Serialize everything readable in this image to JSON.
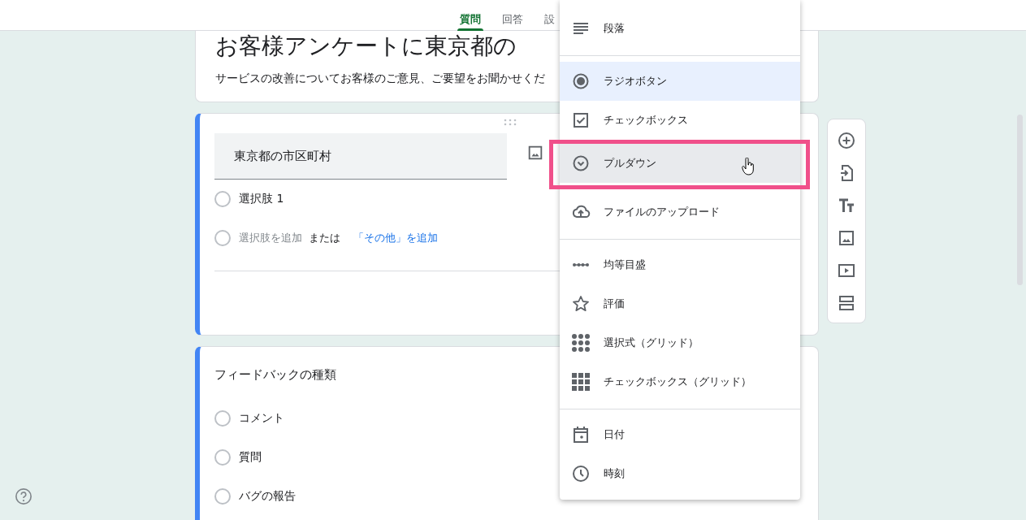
{
  "tabs": [
    {
      "label": "質問",
      "selected": true
    },
    {
      "label": "回答",
      "selected": false
    },
    {
      "label": "設",
      "selected": false
    }
  ],
  "form_header": {
    "title": "お客様アンケートに東京都の",
    "description": "サービスの改善についてお客様のご意見、ご要望をお聞かせくだ"
  },
  "questions": [
    {
      "title": "東京都の市区町村",
      "editing": true,
      "options": [
        "選択肢 1"
      ],
      "add_option": {
        "placeholder": "選択肢を追加",
        "or": "または",
        "other_link": "「その他」を追加"
      }
    },
    {
      "title": "フィードバックの種類",
      "editing": false,
      "options": [
        "コメント",
        "質問",
        "バグの報告"
      ]
    }
  ],
  "question_type_menu": {
    "groups": [
      [
        {
          "label": "段落",
          "selected": false,
          "hovered": false,
          "highlighted": false
        }
      ],
      [
        {
          "label": "ラジオボタン",
          "selected": true,
          "hovered": false,
          "highlighted": false
        },
        {
          "label": "チェックボックス",
          "selected": false,
          "hovered": false,
          "highlighted": false
        },
        {
          "label": "プルダウン",
          "selected": false,
          "hovered": true,
          "highlighted": true
        }
      ],
      [
        {
          "label": "ファイルのアップロード",
          "selected": false,
          "hovered": false,
          "highlighted": false
        }
      ],
      [
        {
          "label": "均等目盛",
          "selected": false,
          "hovered": false,
          "highlighted": false
        },
        {
          "label": "評価",
          "selected": false,
          "hovered": false,
          "highlighted": false
        },
        {
          "label": "選択式（グリッド）",
          "selected": false,
          "hovered": false,
          "highlighted": false
        },
        {
          "label": "チェックボックス（グリッド）",
          "selected": false,
          "hovered": false,
          "highlighted": false
        }
      ],
      [
        {
          "label": "日付",
          "selected": false,
          "hovered": false,
          "highlighted": false
        },
        {
          "label": "時刻",
          "selected": false,
          "hovered": false,
          "highlighted": false
        }
      ]
    ]
  }
}
